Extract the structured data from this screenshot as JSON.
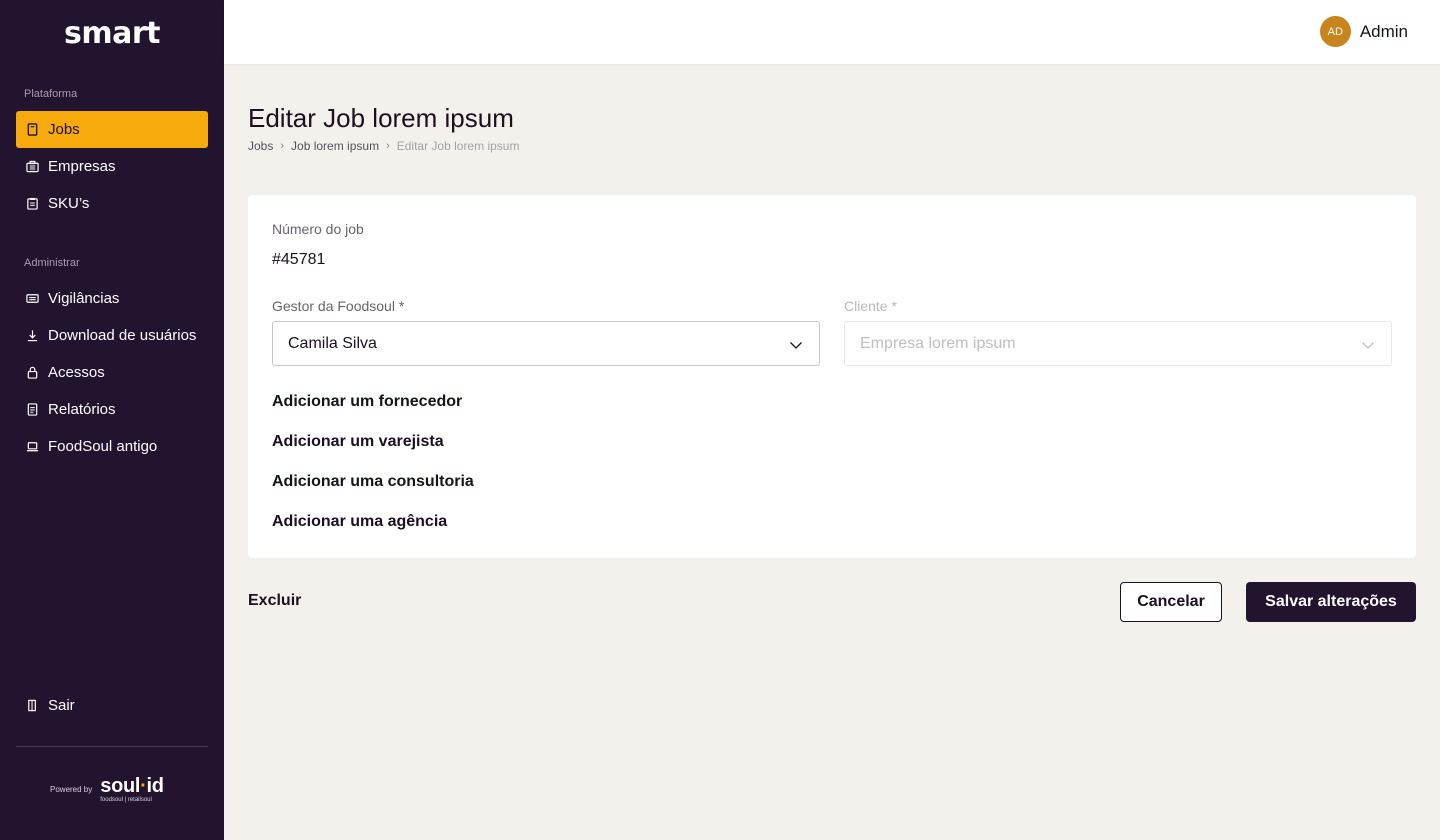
{
  "brand": {
    "logo_text": "smart",
    "powered_by": "Powered by",
    "soulid_main_left": "soul",
    "soulid_dot": "·",
    "soulid_main_right": "id",
    "soulid_sub": "foodsoul | retailsoul",
    "accent_color": "#f6aa0b",
    "sidebar_bg": "#22132e"
  },
  "sidebar": {
    "section_platform": "Plataforma",
    "platform_items": [
      {
        "label": "Jobs",
        "icon": "document-icon",
        "active": true
      },
      {
        "label": "Empresas",
        "icon": "briefcase-icon",
        "active": false
      },
      {
        "label": "SKU’s",
        "icon": "clipboard-icon",
        "active": false
      }
    ],
    "section_admin": "Administrar",
    "admin_items": [
      {
        "label": "Vigilâncias",
        "icon": "monitor-list-icon"
      },
      {
        "label": "Download de usuários",
        "icon": "download-icon"
      },
      {
        "label": "Acessos",
        "icon": "lock-icon"
      },
      {
        "label": "Relatórios",
        "icon": "report-icon"
      },
      {
        "label": "FoodSoul antigo",
        "icon": "laptop-icon"
      }
    ],
    "logout_label": "Sair"
  },
  "topbar": {
    "avatar_initials": "AD",
    "user_name": "Admin"
  },
  "page": {
    "title": "Editar Job lorem ipsum",
    "breadcrumb": [
      "Jobs",
      "Job lorem ipsum",
      "Editar Job lorem ipsum"
    ]
  },
  "form": {
    "job_number_label": "Número do job",
    "job_number_value": "#45781",
    "manager_label": "Gestor da Foodsoul *",
    "manager_value": "Camila Silva",
    "client_label": "Cliente *",
    "client_placeholder": "Empresa lorem ipsum",
    "add_links": [
      "Adicionar um fornecedor",
      "Adicionar um varejista",
      "Adicionar uma consultoria",
      "Adicionar uma agência"
    ]
  },
  "actions": {
    "delete_label": "Excluir",
    "cancel_label": "Cancelar",
    "save_label": "Salvar alterações"
  }
}
